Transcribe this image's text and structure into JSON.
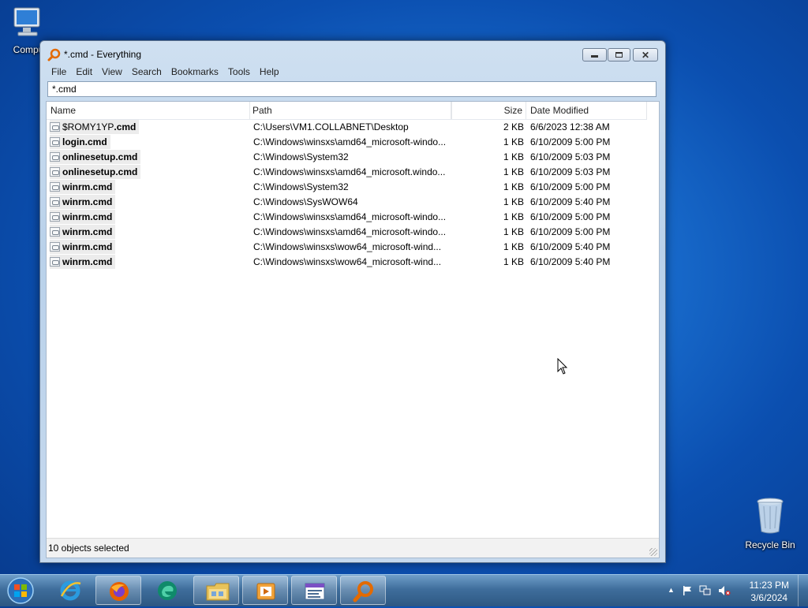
{
  "desktop": {
    "computer_label": "Compu",
    "recycle_label": "Recycle Bin"
  },
  "window": {
    "title": "*.cmd - Everything",
    "menu": [
      "File",
      "Edit",
      "View",
      "Search",
      "Bookmarks",
      "Tools",
      "Help"
    ],
    "search_value": "*.cmd",
    "columns": {
      "name": "Name",
      "path": "Path",
      "size": "Size",
      "date": "Date Modified"
    },
    "rows": [
      {
        "name_pre": "$ROMY1YP",
        "name_ext": ".cmd",
        "path": "C:\\Users\\VM1.COLLABNET\\Desktop",
        "size": "2 KB",
        "date": "6/6/2023 12:38 AM"
      },
      {
        "name_pre": "login",
        "name_ext": ".cmd",
        "path": "C:\\Windows\\winsxs\\amd64_microsoft-windo...",
        "size": "1 KB",
        "date": "6/10/2009 5:00 PM"
      },
      {
        "name_pre": "onlinesetup",
        "name_ext": ".cmd",
        "path": "C:\\Windows\\System32",
        "size": "1 KB",
        "date": "6/10/2009 5:03 PM"
      },
      {
        "name_pre": "onlinesetup",
        "name_ext": ".cmd",
        "path": "C:\\Windows\\winsxs\\amd64_microsoft.windo...",
        "size": "1 KB",
        "date": "6/10/2009 5:03 PM"
      },
      {
        "name_pre": "winrm",
        "name_ext": ".cmd",
        "path": "C:\\Windows\\System32",
        "size": "1 KB",
        "date": "6/10/2009 5:00 PM"
      },
      {
        "name_pre": "winrm",
        "name_ext": ".cmd",
        "path": "C:\\Windows\\SysWOW64",
        "size": "1 KB",
        "date": "6/10/2009 5:40 PM"
      },
      {
        "name_pre": "winrm",
        "name_ext": ".cmd",
        "path": "C:\\Windows\\winsxs\\amd64_microsoft-windo...",
        "size": "1 KB",
        "date": "6/10/2009 5:00 PM"
      },
      {
        "name_pre": "winrm",
        "name_ext": ".cmd",
        "path": "C:\\Windows\\winsxs\\amd64_microsoft-windo...",
        "size": "1 KB",
        "date": "6/10/2009 5:00 PM"
      },
      {
        "name_pre": "winrm",
        "name_ext": ".cmd",
        "path": "C:\\Windows\\winsxs\\wow64_microsoft-wind...",
        "size": "1 KB",
        "date": "6/10/2009 5:40 PM"
      },
      {
        "name_pre": "winrm",
        "name_ext": ".cmd",
        "path": "C:\\Windows\\winsxs\\wow64_microsoft-wind...",
        "size": "1 KB",
        "date": "6/10/2009 5:40 PM"
      }
    ],
    "status": "10 objects selected"
  },
  "taskbar": {
    "pinned": [
      "internet-explorer-icon",
      "firefox-icon",
      "edge-icon",
      "file-explorer-icon",
      "media-player-icon",
      "window-app-icon",
      "everything-search-icon"
    ],
    "clock_time": "11:23 PM",
    "clock_date": "3/6/2024"
  }
}
